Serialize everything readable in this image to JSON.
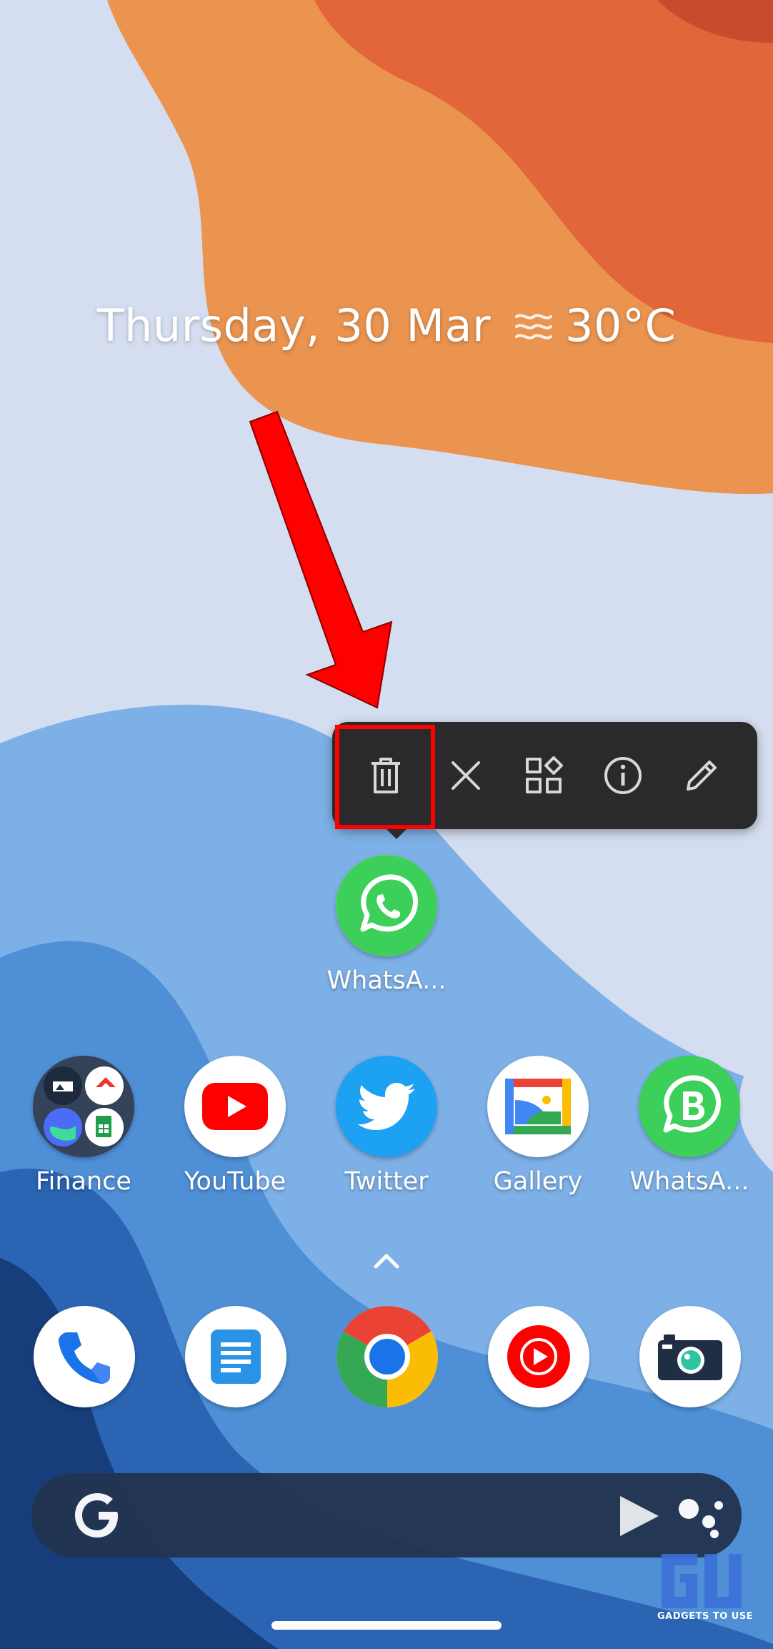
{
  "glance": {
    "date": "Thursday, 30 Mar",
    "weather_icon": "haze-icon",
    "temperature": "30°C"
  },
  "popup": {
    "actions": [
      {
        "name": "delete-button",
        "icon": "trash-icon",
        "highlighted": true
      },
      {
        "name": "remove-button",
        "icon": "close-icon"
      },
      {
        "name": "widgets-button",
        "icon": "widgets-icon"
      },
      {
        "name": "app-info-button",
        "icon": "info-icon"
      },
      {
        "name": "edit-button",
        "icon": "pencil-icon"
      }
    ],
    "highlight_color": "#ff0000"
  },
  "selected_app": {
    "label": "WhatsA...",
    "icon": "whatsapp-icon"
  },
  "apps_row": [
    {
      "label": "Finance",
      "icon": "folder-icon"
    },
    {
      "label": "YouTube",
      "icon": "youtube-icon"
    },
    {
      "label": "Twitter",
      "icon": "twitter-icon"
    },
    {
      "label": "Gallery",
      "icon": "gallery-icon"
    },
    {
      "label": "WhatsA...",
      "icon": "whatsapp-business-icon"
    }
  ],
  "dock": [
    {
      "name": "phone",
      "icon": "phone-icon"
    },
    {
      "name": "docs",
      "icon": "docs-icon"
    },
    {
      "name": "chrome",
      "icon": "chrome-icon"
    },
    {
      "name": "youtube-music",
      "icon": "youtube-music-icon"
    },
    {
      "name": "camera",
      "icon": "camera-icon"
    }
  ],
  "search_bar": {
    "left_icon": "google-g-icon",
    "right_icons": [
      "play-icon",
      "assistant-icon"
    ]
  },
  "watermark": {
    "logo": "GU",
    "text": "GADGETS TO USE"
  },
  "colors": {
    "wallpaper_light": "#d5def0",
    "wallpaper_orange": "#ea9450",
    "wallpaper_red": "#e2663a",
    "wallpaper_blue": "#7db0e6",
    "wallpaper_navy": "#173e7a",
    "popup_bg": "#2a2a2c",
    "arrow": "#ff0000"
  }
}
